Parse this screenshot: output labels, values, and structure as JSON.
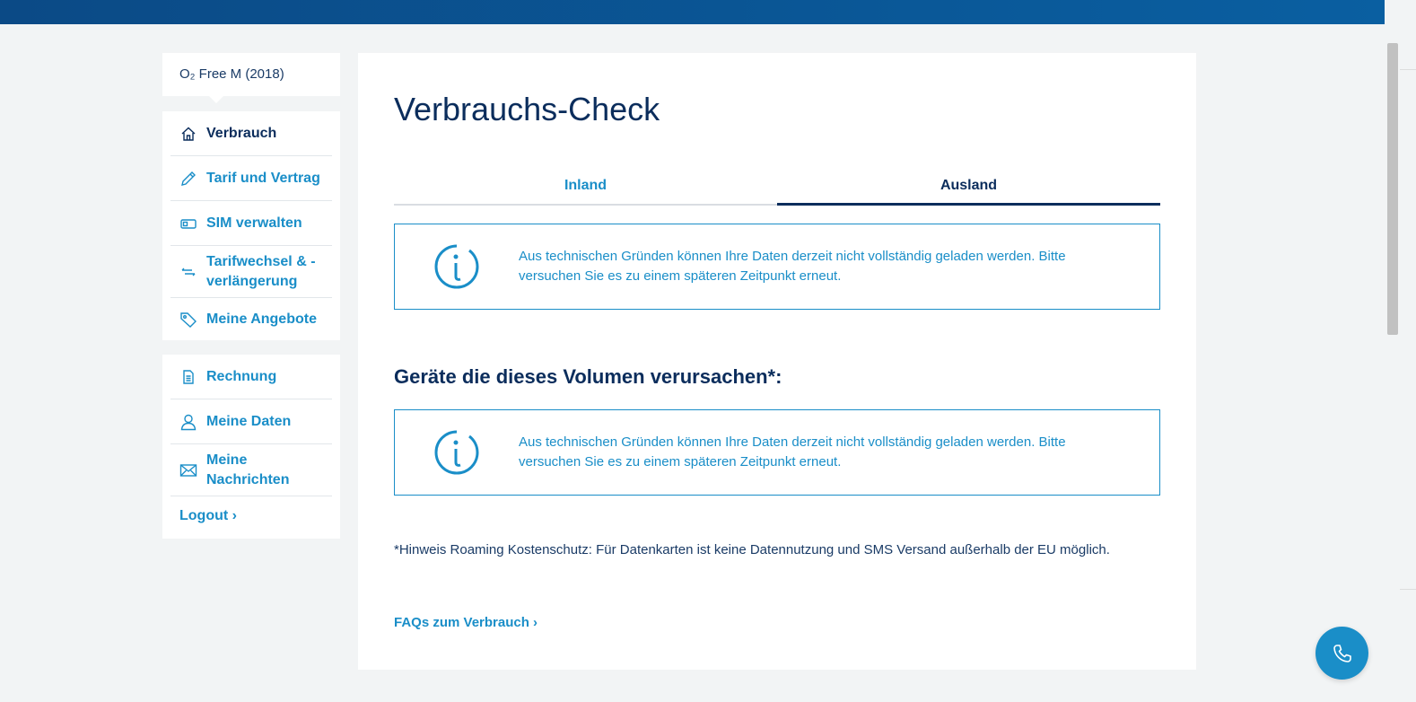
{
  "sidebar": {
    "tariff_name": "O₂ Free M (2018)",
    "primary_items": [
      {
        "label": "Verbrauch",
        "icon": "home-icon",
        "active": true
      },
      {
        "label": "Tarif und Vertrag",
        "icon": "pencil-icon"
      },
      {
        "label": "SIM verwalten",
        "icon": "sim-card-icon"
      },
      {
        "label": "Tarifwechsel & -verlängerung",
        "icon": "switch-arrows-icon"
      },
      {
        "label": "Meine Angebote",
        "icon": "tag-icon"
      }
    ],
    "secondary_items": [
      {
        "label": "Rechnung",
        "icon": "document-icon"
      },
      {
        "label": "Meine Daten",
        "icon": "user-icon"
      },
      {
        "label": "Meine Nachrichten",
        "icon": "envelope-icon"
      }
    ],
    "logout_label": "Logout ›"
  },
  "main": {
    "title": "Verbrauchs-Check",
    "tabs": [
      {
        "label": "Inland",
        "active": false
      },
      {
        "label": "Ausland",
        "active": true
      }
    ],
    "info_message_1": "Aus technischen Gründen können Ihre Daten derzeit nicht vollständig geladen werden. Bitte versuchen Sie es zu einem späteren Zeitpunkt erneut.",
    "devices_heading": "Geräte die dieses Volumen verursachen*:",
    "info_message_2": "Aus technischen Gründen können Ihre Daten derzeit nicht vollständig geladen werden. Bitte versuchen Sie es zu einem späteren Zeitpunkt erneut.",
    "roaming_hint": "*Hinweis Roaming Kostenschutz: Für Datenkarten ist keine Datennutzung und SMS Versand außerhalb der EU möglich.",
    "faq_link": "FAQs zum Verbrauch ›"
  },
  "colors": {
    "accent": "#1a8ec8",
    "navy": "#0b2d5c",
    "topbar": "#0b4a86"
  }
}
